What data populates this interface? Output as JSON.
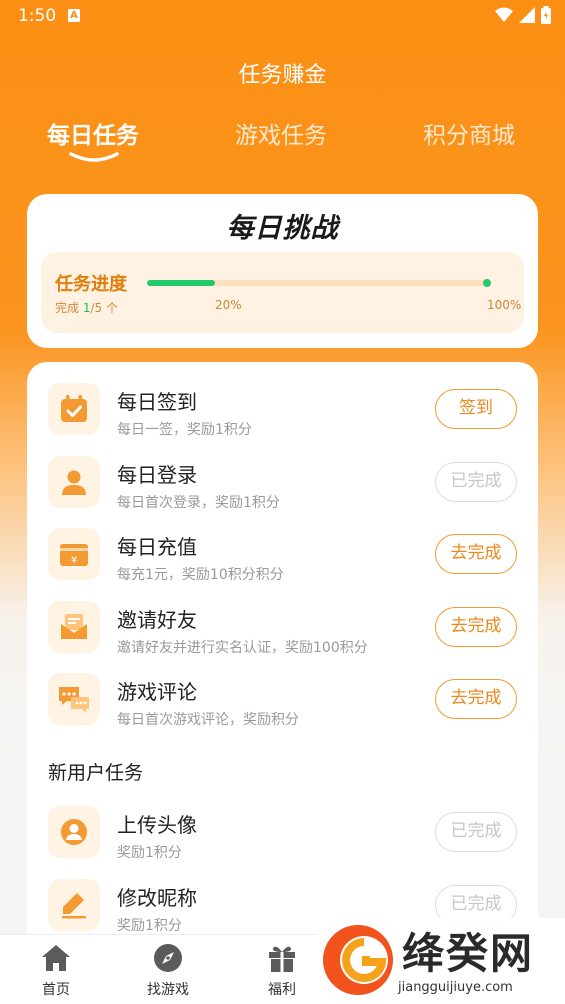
{
  "status_bar": {
    "time": "1:50",
    "badge": "A"
  },
  "header": {
    "title": "任务赚金"
  },
  "tabs": [
    {
      "label": "每日任务",
      "active": true
    },
    {
      "label": "游戏任务",
      "active": false
    },
    {
      "label": "积分商城",
      "active": false
    }
  ],
  "challenge": {
    "title": "每日挑战",
    "progress_label": "任务进度",
    "count_prefix": "完成 ",
    "count_done": "1",
    "count_suffix": "/5 个",
    "percent_label": "20%",
    "percent_value": 20,
    "max_label": "100%"
  },
  "daily_tasks": [
    {
      "title": "每日签到",
      "desc": "每日一签，奖励1积分",
      "button": "签到",
      "done": false,
      "icon": "calendar-check-icon"
    },
    {
      "title": "每日登录",
      "desc": "每日首次登录，奖励1积分",
      "button": "已完成",
      "done": true,
      "icon": "user-icon"
    },
    {
      "title": "每日充值",
      "desc": "每充1元，奖励10积分积分",
      "button": "去完成",
      "done": false,
      "icon": "wallet-yen-icon"
    },
    {
      "title": "邀请好友",
      "desc": "邀请好友并进行实名认证，奖励100积分",
      "button": "去完成",
      "done": false,
      "icon": "envelope-icon"
    },
    {
      "title": "游戏评论",
      "desc": "每日首次游戏评论，奖励积分",
      "button": "去完成",
      "done": false,
      "icon": "chat-bubbles-icon"
    }
  ],
  "new_user_section": {
    "title": "新用户任务"
  },
  "new_user_tasks": [
    {
      "title": "上传头像",
      "desc": "奖励1积分",
      "button": "已完成",
      "done": true,
      "icon": "avatar-circle-icon"
    },
    {
      "title": "修改昵称",
      "desc": "奖励1积分",
      "button": "已完成",
      "done": true,
      "icon": "pencil-icon"
    }
  ],
  "bottom_nav": [
    {
      "label": "首页",
      "icon": "home-icon"
    },
    {
      "label": "找游戏",
      "icon": "compass-icon"
    },
    {
      "label": "福利",
      "icon": "gift-icon"
    }
  ],
  "watermark": {
    "text": "绛癸网",
    "url": "jiangguijiuye.com"
  },
  "colors": {
    "brand": "#FB8F13",
    "accent_green": "#23C968",
    "button_orange": "#F0871A",
    "done_gray": "#C6C6C6"
  }
}
